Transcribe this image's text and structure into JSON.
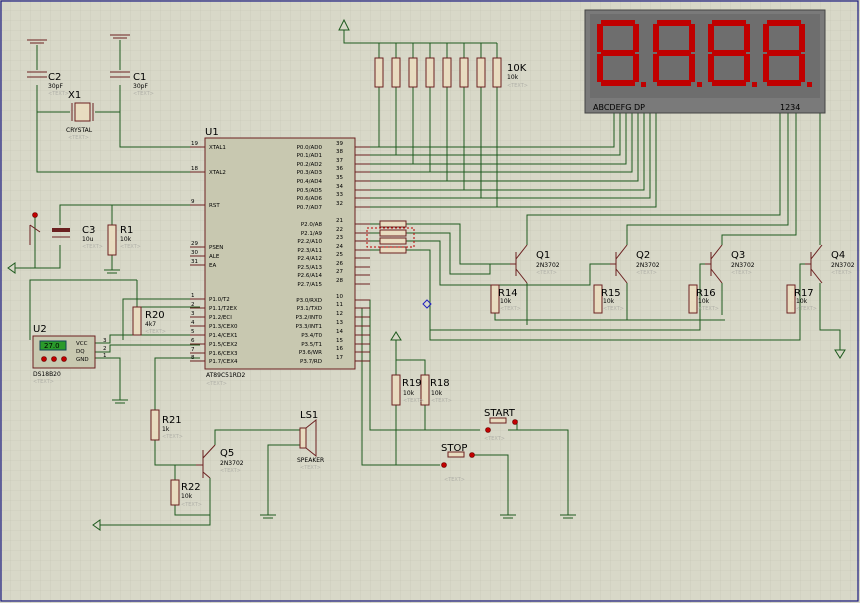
{
  "u1": {
    "ref": "U1",
    "part": "AT89C51RD2",
    "text_placeholder": "<TEXT>",
    "left_pins": [
      {
        "num": "19",
        "name": "XTAL1"
      },
      {
        "num": "18",
        "name": "XTAL2"
      },
      {
        "num": "9",
        "name": "RST"
      },
      {
        "num": "29",
        "name": "PSEN"
      },
      {
        "num": "30",
        "name": "ALE"
      },
      {
        "num": "31",
        "name": "EA"
      },
      {
        "num": "1",
        "name": "P1.0/T2"
      },
      {
        "num": "2",
        "name": "P1.1/T2EX"
      },
      {
        "num": "3",
        "name": "P1.2/ECI"
      },
      {
        "num": "4",
        "name": "P1.3/CEX0"
      },
      {
        "num": "5",
        "name": "P1.4/CEX1"
      },
      {
        "num": "6",
        "name": "P1.5/CEX2"
      },
      {
        "num": "7",
        "name": "P1.6/CEX3"
      },
      {
        "num": "8",
        "name": "P1.7/CEX4"
      }
    ],
    "right_pins": [
      {
        "num": "39",
        "name": "P0.0/AD0"
      },
      {
        "num": "38",
        "name": "P0.1/AD1"
      },
      {
        "num": "37",
        "name": "P0.2/AD2"
      },
      {
        "num": "36",
        "name": "P0.3/AD3"
      },
      {
        "num": "35",
        "name": "P0.4/AD4"
      },
      {
        "num": "34",
        "name": "P0.5/AD5"
      },
      {
        "num": "33",
        "name": "P0.6/AD6"
      },
      {
        "num": "32",
        "name": "P0.7/AD7"
      },
      {
        "num": "21",
        "name": "P2.0/A8"
      },
      {
        "num": "22",
        "name": "P2.1/A9"
      },
      {
        "num": "23",
        "name": "P2.2/A10"
      },
      {
        "num": "24",
        "name": "P2.3/A11"
      },
      {
        "num": "25",
        "name": "P2.4/A12"
      },
      {
        "num": "26",
        "name": "P2.5/A13"
      },
      {
        "num": "27",
        "name": "P2.6/A14"
      },
      {
        "num": "28",
        "name": "P2.7/A15"
      },
      {
        "num": "10",
        "name": "P3.0/RXD"
      },
      {
        "num": "11",
        "name": "P3.1/TXD"
      },
      {
        "num": "12",
        "name": "P3.2/INT0"
      },
      {
        "num": "13",
        "name": "P3.3/INT1"
      },
      {
        "num": "14",
        "name": "P3.4/T0"
      },
      {
        "num": "15",
        "name": "P3.5/T1"
      },
      {
        "num": "16",
        "name": "P3.6/WR"
      },
      {
        "num": "17",
        "name": "P3.7/RD"
      }
    ]
  },
  "display": {
    "segments_label": "ABCDEFG DP",
    "digits_label": "1234"
  },
  "rnet": {
    "ref": "10K",
    "val": "10k",
    "text": "<TEXT>"
  },
  "c1": {
    "ref": "C1",
    "val": "30pF",
    "text": "<TEXT>"
  },
  "c2": {
    "ref": "C2",
    "val": "30pF",
    "text": "<TEXT>"
  },
  "x1": {
    "ref": "X1",
    "val": "CRYSTAL",
    "text": "<TEXT>"
  },
  "c3": {
    "ref": "C3",
    "val": "10u",
    "text": "<TEXT>"
  },
  "r1": {
    "ref": "R1",
    "val": "10k",
    "text": "<TEXT>"
  },
  "r20": {
    "ref": "R20",
    "val": "4k7",
    "text": "<TEXT>"
  },
  "u2": {
    "ref": "U2",
    "part": "DS18B20",
    "readout": "27.0",
    "pins": [
      "VCC",
      "DQ",
      "GND"
    ],
    "pin_nums": [
      "3",
      "2",
      "1"
    ],
    "text": "<TEXT>"
  },
  "q1": {
    "ref": "Q1",
    "val": "2N3702",
    "text": "<TEXT>"
  },
  "q2": {
    "ref": "Q2",
    "val": "2N3702",
    "text": "<TEXT>"
  },
  "q3": {
    "ref": "Q3",
    "val": "2N3702",
    "text": "<TEXT>"
  },
  "q4": {
    "ref": "Q4",
    "val": "2N3702",
    "text": "<TEXT>"
  },
  "q5": {
    "ref": "Q5",
    "val": "2N3702",
    "text": "<TEXT>"
  },
  "r14": {
    "ref": "R14",
    "val": "10k",
    "text": "<TEXT>"
  },
  "r15": {
    "ref": "R15",
    "val": "10k",
    "text": "<TEXT>"
  },
  "r16": {
    "ref": "R16",
    "val": "10k",
    "text": "<TEXT>"
  },
  "r17": {
    "ref": "R17",
    "val": "10k",
    "text": "<TEXT>"
  },
  "r18": {
    "ref": "R18",
    "val": "10k",
    "text": "<TEXT>"
  },
  "r19": {
    "ref": "R19",
    "val": "10k",
    "text": "<TEXT>"
  },
  "r21": {
    "ref": "R21",
    "val": "1k",
    "text": "<TEXT>"
  },
  "r22": {
    "ref": "R22",
    "val": "10k",
    "text": "<TEXT>"
  },
  "ls1": {
    "ref": "LS1",
    "val": "SPEAKER",
    "text": "<TEXT>"
  },
  "start": {
    "ref": "START",
    "text": "<TEXT>"
  },
  "stop": {
    "ref": "STOP",
    "text": "<TEXT>"
  },
  "colors": {
    "background": "#d8d8c8",
    "grid": "#c4c4b4",
    "wire": "#1e5a1e",
    "component": "#6b2020",
    "chip_fill": "#c8c8b0",
    "display_bg": "#7a7a7a",
    "segment_on": "#c00000"
  }
}
